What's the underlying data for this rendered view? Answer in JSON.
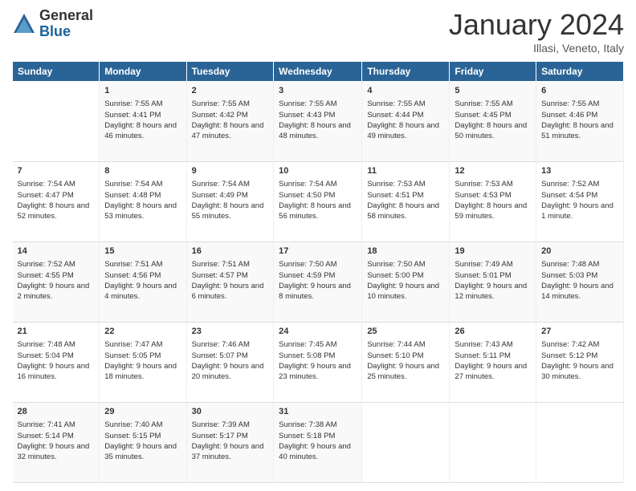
{
  "logo": {
    "general": "General",
    "blue": "Blue"
  },
  "header": {
    "month": "January 2024",
    "location": "Illasi, Veneto, Italy"
  },
  "days": [
    "Sunday",
    "Monday",
    "Tuesday",
    "Wednesday",
    "Thursday",
    "Friday",
    "Saturday"
  ],
  "weeks": [
    [
      {
        "num": "",
        "sunrise": "",
        "sunset": "",
        "daylight": ""
      },
      {
        "num": "1",
        "sunrise": "Sunrise: 7:55 AM",
        "sunset": "Sunset: 4:41 PM",
        "daylight": "Daylight: 8 hours and 46 minutes."
      },
      {
        "num": "2",
        "sunrise": "Sunrise: 7:55 AM",
        "sunset": "Sunset: 4:42 PM",
        "daylight": "Daylight: 8 hours and 47 minutes."
      },
      {
        "num": "3",
        "sunrise": "Sunrise: 7:55 AM",
        "sunset": "Sunset: 4:43 PM",
        "daylight": "Daylight: 8 hours and 48 minutes."
      },
      {
        "num": "4",
        "sunrise": "Sunrise: 7:55 AM",
        "sunset": "Sunset: 4:44 PM",
        "daylight": "Daylight: 8 hours and 49 minutes."
      },
      {
        "num": "5",
        "sunrise": "Sunrise: 7:55 AM",
        "sunset": "Sunset: 4:45 PM",
        "daylight": "Daylight: 8 hours and 50 minutes."
      },
      {
        "num": "6",
        "sunrise": "Sunrise: 7:55 AM",
        "sunset": "Sunset: 4:46 PM",
        "daylight": "Daylight: 8 hours and 51 minutes."
      }
    ],
    [
      {
        "num": "7",
        "sunrise": "Sunrise: 7:54 AM",
        "sunset": "Sunset: 4:47 PM",
        "daylight": "Daylight: 8 hours and 52 minutes."
      },
      {
        "num": "8",
        "sunrise": "Sunrise: 7:54 AM",
        "sunset": "Sunset: 4:48 PM",
        "daylight": "Daylight: 8 hours and 53 minutes."
      },
      {
        "num": "9",
        "sunrise": "Sunrise: 7:54 AM",
        "sunset": "Sunset: 4:49 PM",
        "daylight": "Daylight: 8 hours and 55 minutes."
      },
      {
        "num": "10",
        "sunrise": "Sunrise: 7:54 AM",
        "sunset": "Sunset: 4:50 PM",
        "daylight": "Daylight: 8 hours and 56 minutes."
      },
      {
        "num": "11",
        "sunrise": "Sunrise: 7:53 AM",
        "sunset": "Sunset: 4:51 PM",
        "daylight": "Daylight: 8 hours and 58 minutes."
      },
      {
        "num": "12",
        "sunrise": "Sunrise: 7:53 AM",
        "sunset": "Sunset: 4:53 PM",
        "daylight": "Daylight: 8 hours and 59 minutes."
      },
      {
        "num": "13",
        "sunrise": "Sunrise: 7:52 AM",
        "sunset": "Sunset: 4:54 PM",
        "daylight": "Daylight: 9 hours and 1 minute."
      }
    ],
    [
      {
        "num": "14",
        "sunrise": "Sunrise: 7:52 AM",
        "sunset": "Sunset: 4:55 PM",
        "daylight": "Daylight: 9 hours and 2 minutes."
      },
      {
        "num": "15",
        "sunrise": "Sunrise: 7:51 AM",
        "sunset": "Sunset: 4:56 PM",
        "daylight": "Daylight: 9 hours and 4 minutes."
      },
      {
        "num": "16",
        "sunrise": "Sunrise: 7:51 AM",
        "sunset": "Sunset: 4:57 PM",
        "daylight": "Daylight: 9 hours and 6 minutes."
      },
      {
        "num": "17",
        "sunrise": "Sunrise: 7:50 AM",
        "sunset": "Sunset: 4:59 PM",
        "daylight": "Daylight: 9 hours and 8 minutes."
      },
      {
        "num": "18",
        "sunrise": "Sunrise: 7:50 AM",
        "sunset": "Sunset: 5:00 PM",
        "daylight": "Daylight: 9 hours and 10 minutes."
      },
      {
        "num": "19",
        "sunrise": "Sunrise: 7:49 AM",
        "sunset": "Sunset: 5:01 PM",
        "daylight": "Daylight: 9 hours and 12 minutes."
      },
      {
        "num": "20",
        "sunrise": "Sunrise: 7:48 AM",
        "sunset": "Sunset: 5:03 PM",
        "daylight": "Daylight: 9 hours and 14 minutes."
      }
    ],
    [
      {
        "num": "21",
        "sunrise": "Sunrise: 7:48 AM",
        "sunset": "Sunset: 5:04 PM",
        "daylight": "Daylight: 9 hours and 16 minutes."
      },
      {
        "num": "22",
        "sunrise": "Sunrise: 7:47 AM",
        "sunset": "Sunset: 5:05 PM",
        "daylight": "Daylight: 9 hours and 18 minutes."
      },
      {
        "num": "23",
        "sunrise": "Sunrise: 7:46 AM",
        "sunset": "Sunset: 5:07 PM",
        "daylight": "Daylight: 9 hours and 20 minutes."
      },
      {
        "num": "24",
        "sunrise": "Sunrise: 7:45 AM",
        "sunset": "Sunset: 5:08 PM",
        "daylight": "Daylight: 9 hours and 23 minutes."
      },
      {
        "num": "25",
        "sunrise": "Sunrise: 7:44 AM",
        "sunset": "Sunset: 5:10 PM",
        "daylight": "Daylight: 9 hours and 25 minutes."
      },
      {
        "num": "26",
        "sunrise": "Sunrise: 7:43 AM",
        "sunset": "Sunset: 5:11 PM",
        "daylight": "Daylight: 9 hours and 27 minutes."
      },
      {
        "num": "27",
        "sunrise": "Sunrise: 7:42 AM",
        "sunset": "Sunset: 5:12 PM",
        "daylight": "Daylight: 9 hours and 30 minutes."
      }
    ],
    [
      {
        "num": "28",
        "sunrise": "Sunrise: 7:41 AM",
        "sunset": "Sunset: 5:14 PM",
        "daylight": "Daylight: 9 hours and 32 minutes."
      },
      {
        "num": "29",
        "sunrise": "Sunrise: 7:40 AM",
        "sunset": "Sunset: 5:15 PM",
        "daylight": "Daylight: 9 hours and 35 minutes."
      },
      {
        "num": "30",
        "sunrise": "Sunrise: 7:39 AM",
        "sunset": "Sunset: 5:17 PM",
        "daylight": "Daylight: 9 hours and 37 minutes."
      },
      {
        "num": "31",
        "sunrise": "Sunrise: 7:38 AM",
        "sunset": "Sunset: 5:18 PM",
        "daylight": "Daylight: 9 hours and 40 minutes."
      },
      {
        "num": "",
        "sunrise": "",
        "sunset": "",
        "daylight": ""
      },
      {
        "num": "",
        "sunrise": "",
        "sunset": "",
        "daylight": ""
      },
      {
        "num": "",
        "sunrise": "",
        "sunset": "",
        "daylight": ""
      }
    ]
  ]
}
